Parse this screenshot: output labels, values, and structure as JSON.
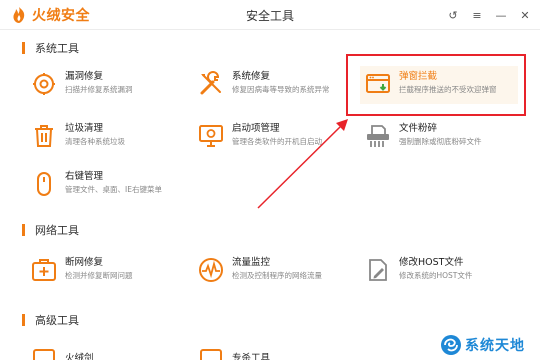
{
  "app": {
    "brand": "火绒安全",
    "title": "安全工具"
  },
  "window_controls": [
    {
      "icon": "refresh-icon",
      "glyph": "↺"
    },
    {
      "icon": "menu-icon",
      "glyph": "≡"
    },
    {
      "icon": "minimize-icon",
      "glyph": "—"
    },
    {
      "icon": "close-icon",
      "glyph": "✕"
    }
  ],
  "sections": {
    "system": "系统工具",
    "network": "网络工具",
    "advanced": "高级工具"
  },
  "tools": {
    "vuln_fix": {
      "name": "漏洞修复",
      "desc": "扫描并修复系统漏洞",
      "icon": "shield-gear-icon"
    },
    "sys_repair": {
      "name": "系统修复",
      "desc": "修复因病毒等导致的系统异常",
      "icon": "wrench-screwdriver-icon"
    },
    "popup_block": {
      "name": "弹窗拦截",
      "desc": "拦截程序推送的不受欢迎弹窗",
      "icon": "popup-window-icon"
    },
    "junk_clean": {
      "name": "垃圾清理",
      "desc": "清理各种系统垃圾",
      "icon": "trash-icon"
    },
    "startup": {
      "name": "启动项管理",
      "desc": "管理各类软件的开机自启动",
      "icon": "startup-monitor-icon"
    },
    "shredder": {
      "name": "文件粉碎",
      "desc": "强制删除或彻底粉碎文件",
      "icon": "shredder-icon"
    },
    "context_menu": {
      "name": "右键管理",
      "desc": "管理文件、桌面、IE右键菜单",
      "icon": "mouse-icon"
    },
    "net_repair": {
      "name": "断网修复",
      "desc": "检测并修复断网问题",
      "icon": "first-aid-icon"
    },
    "traffic": {
      "name": "流量监控",
      "desc": "检测及控制程序的网络流量",
      "icon": "pulse-icon"
    },
    "hosts": {
      "name": "修改HOST文件",
      "desc": "修改系统的HOST文件",
      "icon": "edit-document-icon"
    },
    "adv_1": {
      "name": "火绒剑",
      "icon": "sword-icon"
    },
    "adv_2": {
      "name": "专杀工具",
      "icon": "tool-icon"
    }
  },
  "watermark": {
    "text": "系统天地",
    "icon": "swirl-logo-icon"
  },
  "colors": {
    "accent": "#f07d14",
    "annotation_red": "#e8232a",
    "watermark_blue": "#1e88d6"
  }
}
